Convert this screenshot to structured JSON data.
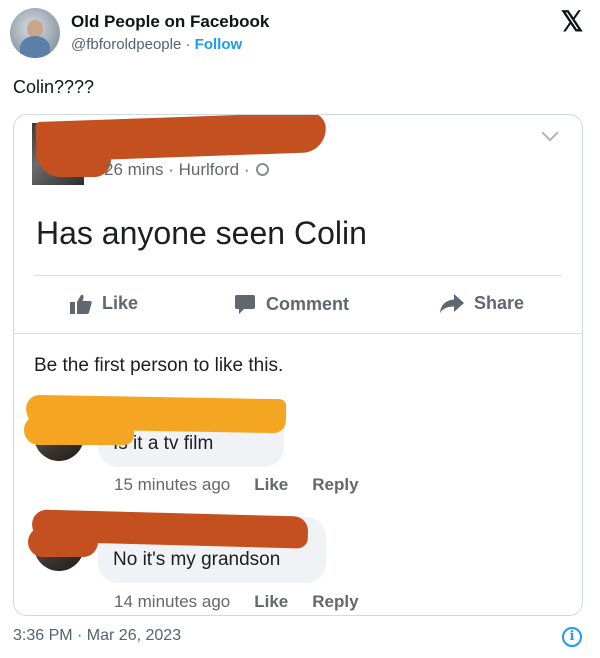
{
  "tweet": {
    "account_name": "Old People on Facebook",
    "handle": "@fbforoldpeople",
    "separator": " · ",
    "follow_label": "Follow",
    "text": "Colin????",
    "timestamp": "3:36 PM · Mar 26, 2023",
    "x_logo": "𝕏",
    "info_glyph": "i",
    "icons": [
      "x-logo-icon",
      "info-icon"
    ]
  },
  "post": {
    "meta_time": "26 mins",
    "meta_location": "Hurlford",
    "meta_separator": " · ",
    "body": "Has anyone seen Colin",
    "actions": {
      "like": "Like",
      "comment": "Comment",
      "share": "Share"
    },
    "likes_text": "Be the first person to like this.",
    "redaction_colors": [
      "#c4501f",
      "#f4a623"
    ],
    "icons": [
      "globe-icon",
      "chevron-down-icon",
      "thumbs-up-icon",
      "comment-icon",
      "share-arrow-icon"
    ]
  },
  "comments": [
    {
      "text": "Is it a tv film",
      "time": "15 minutes ago",
      "like_label": "Like",
      "reply_label": "Reply"
    },
    {
      "text": "No it's my grandson",
      "time": "14 minutes ago",
      "like_label": "Like",
      "reply_label": "Reply"
    }
  ]
}
